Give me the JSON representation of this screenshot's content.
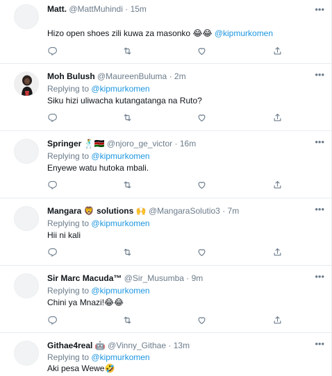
{
  "tweets": [
    {
      "name": "Matt.",
      "name_extra": "",
      "handle": "@MattMuhindi",
      "time": "15m",
      "replying_label": "",
      "replying_to": "",
      "text": "Hizo open shoes zili kuwa za masonko 😂😂",
      "text_mention": "@kipmurkomen",
      "avatar": "blank"
    },
    {
      "name": "Moh Bulush",
      "name_extra": "",
      "handle": "@MaureenBuluma",
      "time": "2m",
      "replying_label": "Replying to",
      "replying_to": "@kipmurkomen",
      "text": "Siku hizi uliwacha kutangatanga na Ruto?",
      "text_mention": "",
      "avatar": "photo-person"
    },
    {
      "name": "Springer",
      "name_extra": "🕺🇰🇪",
      "handle": "@njoro_ge_victor",
      "time": "16m",
      "replying_label": "Replying to",
      "replying_to": "@kipmurkomen",
      "text": "Enyewe watu hutoka mbali.",
      "text_mention": "",
      "avatar": "blank"
    },
    {
      "name": "Mangara",
      "name_extra": "🦁 solutions 🙌",
      "handle": "@MangaraSolutio3",
      "time": "7m",
      "replying_label": "Replying to",
      "replying_to": "@kipmurkomen",
      "text": "Hii ni kali",
      "text_mention": "",
      "avatar": "blank"
    },
    {
      "name": "Sir Marc Macuda™",
      "name_extra": "",
      "handle": "@Sir_Musumba",
      "time": "9m",
      "replying_label": "Replying to",
      "replying_to": "@kipmurkomen",
      "text": "Chini ya Mnazi!😂😂",
      "text_mention": "",
      "avatar": "blank"
    },
    {
      "name": "Githae4real",
      "name_extra": "🤖",
      "handle": "@Vinny_Githae",
      "time": "13m",
      "replying_label": "Replying to",
      "replying_to": "@kipmurkomen",
      "text": "Aki pesa Wewe🤣",
      "text_mention": "",
      "avatar": "blank"
    }
  ],
  "separator": "·",
  "actions": [
    "reply-icon",
    "retweet-icon",
    "like-icon",
    "share-icon"
  ],
  "more_icon": "more-icon",
  "colors": {
    "link": "#1b95e0",
    "muted": "#6b7b8a",
    "text": "#0f1419",
    "divider": "#e6ecf0"
  }
}
